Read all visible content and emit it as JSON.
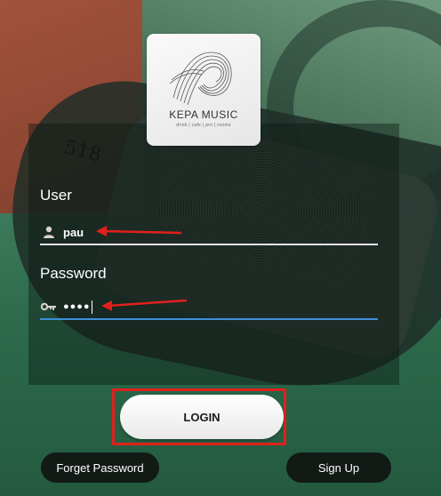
{
  "logo": {
    "title": "KEPA MUSIC",
    "subtitle": "drink | cafe | pro | rooms"
  },
  "form": {
    "user_label": "User",
    "user_value": "pau",
    "password_label": "Password",
    "password_mask": "●●●●"
  },
  "buttons": {
    "login": "LOGIN",
    "forget_password": "Forget Password",
    "sign_up": "Sign Up"
  },
  "background": {
    "box_text": "518"
  },
  "colors": {
    "highlight": "#e0201c",
    "arrow": "#e0201c",
    "password_underline": "#3d8fd8"
  },
  "icons": {
    "user_field": "user-icon",
    "password_field": "key-icon"
  }
}
